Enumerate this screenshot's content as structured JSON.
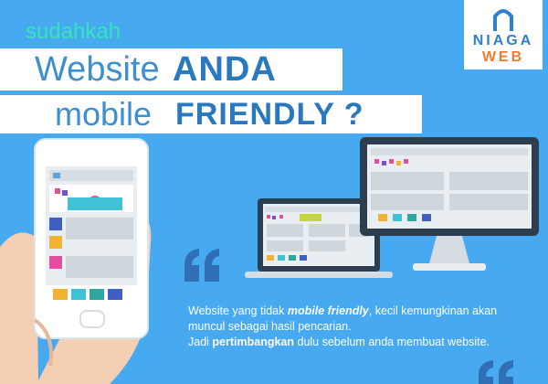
{
  "kicker": "sudahkah",
  "line1": {
    "light": "Website",
    "heavy": "ANDA"
  },
  "line2": {
    "light": "mobile",
    "heavy": "FRIENDLY ?"
  },
  "logo": {
    "top": "NIAGA",
    "bottom": "WEB"
  },
  "paragraph": {
    "p1_a": "Website yang tidak ",
    "p1_b": "mobile friendly",
    "p1_c": ", kecil kemungkinan akan",
    "p2": "muncul sebagai hasil pencarian.",
    "p3_a": "Jadi ",
    "p3_b": "pertimbangkan",
    "p3_c": " dulu sebelum anda membuat website."
  },
  "colors": {
    "background": "#47a9f0",
    "accent_green": "#34e6b8",
    "heading_blue": "#2a78bf",
    "logo_orange": "#f07a33",
    "quote": "#2f6fb5"
  },
  "icons": [
    "hand-phone-illustration",
    "laptop-illustration",
    "desktop-monitor-illustration",
    "quote-mark-icon"
  ]
}
